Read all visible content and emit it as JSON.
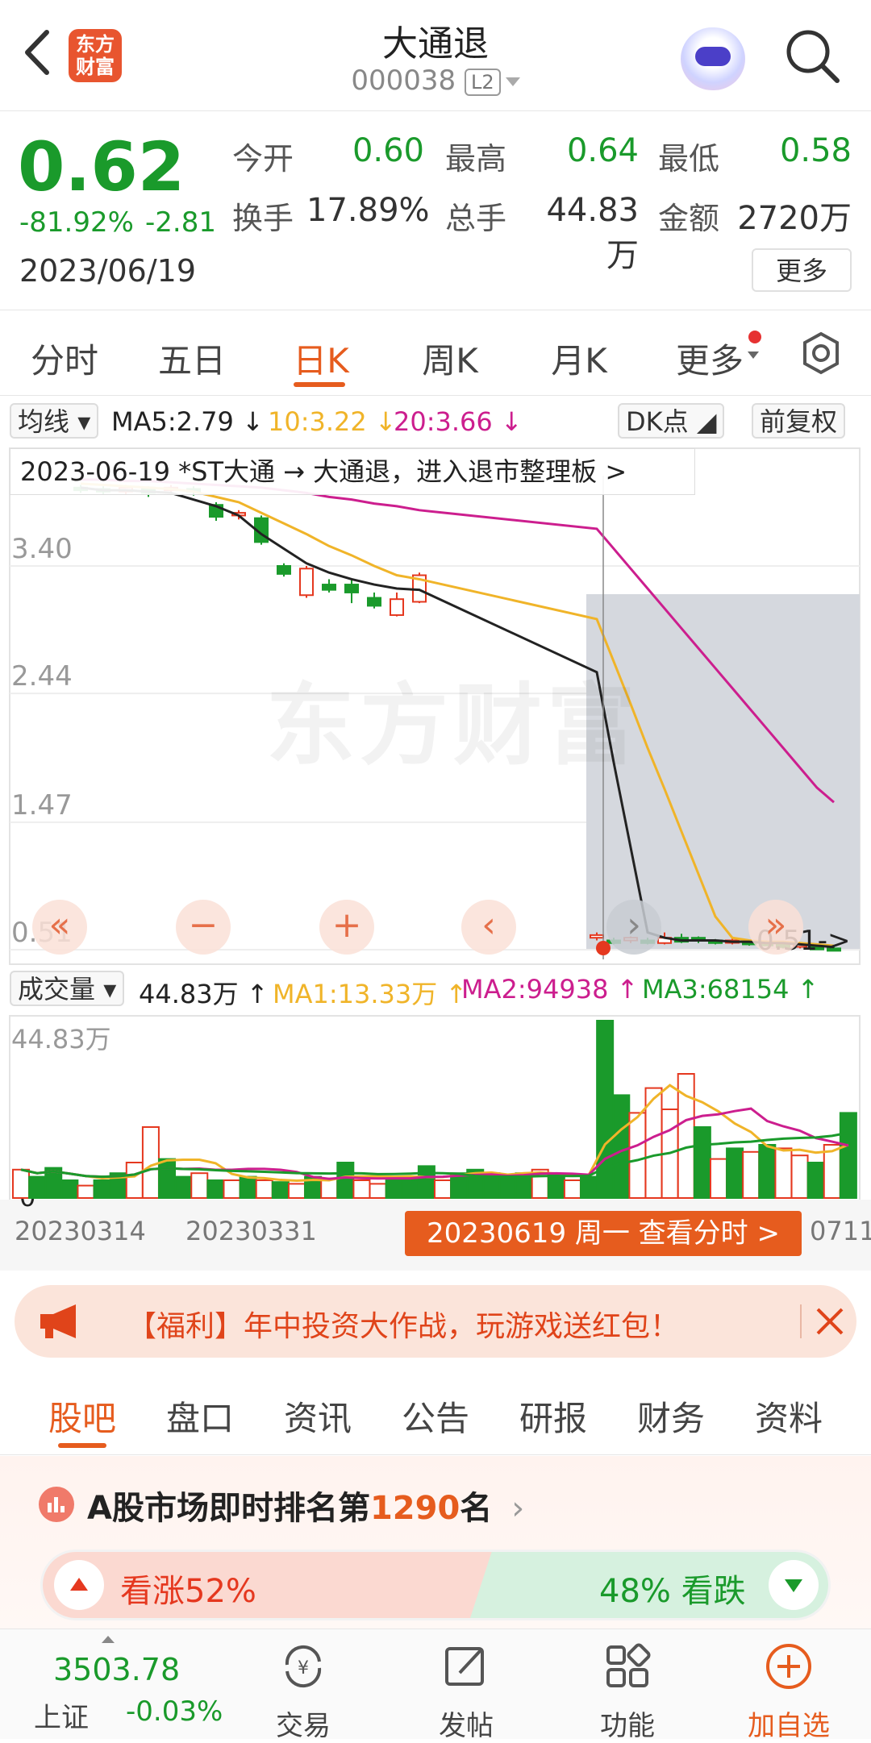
{
  "header": {
    "logo_text": "东方财富",
    "stock_name": "大通退",
    "stock_code": "000038",
    "level_badge": "L2",
    "icons": [
      "back-icon",
      "robot-avatar-icon",
      "search-icon"
    ]
  },
  "quote": {
    "price": "0.62",
    "change_pct": "-81.92%",
    "change": "-2.81",
    "date": "2023/06/19",
    "open_label": "今开",
    "open": "0.60",
    "high_label": "最高",
    "high": "0.64",
    "low_label": "最低",
    "low": "0.58",
    "turnover_label": "换手",
    "turnover": "17.89%",
    "volume_label": "总手",
    "volume": "44.83万",
    "amount_label": "金额",
    "amount": "2720万",
    "more_label": "更多",
    "colors": {
      "down": "#1a9a2b",
      "up": "#e5381f"
    }
  },
  "period_tabs": {
    "items": [
      "分时",
      "五日",
      "日K",
      "周K",
      "月K",
      "更多"
    ],
    "active": "日K"
  },
  "ma_legend": {
    "selector": "均线",
    "ma5": "MA5:2.79 ↓",
    "ma10": "10:3.22 ↓",
    "ma20": "20:3.66 ↓",
    "dk_label": "DK点",
    "adjust_label": "前复权",
    "colors": {
      "ma5": "#222222",
      "ma10": "#f0b429",
      "ma20": "#cc1e8e"
    }
  },
  "chart_data": {
    "type": "candlestick",
    "event_banner": "2023-06-19 *ST大通 → 大通退，进入退市整理板 >",
    "watermark": "东方财富",
    "y_ticks": [
      "3.40",
      "2.44",
      "1.47",
      "0.51"
    ],
    "last_label": "0.51->",
    "x_ticks": [
      "20230314",
      "20230331",
      "0711"
    ],
    "ylim": [
      0.51,
      4.0
    ],
    "candles": [
      {
        "o": 3.99,
        "c": 3.97,
        "h": 4.01,
        "l": 3.95
      },
      {
        "o": 3.98,
        "c": 3.96,
        "h": 4.0,
        "l": 3.94
      },
      {
        "o": 3.96,
        "c": 3.99,
        "h": 4.01,
        "l": 3.94
      },
      {
        "o": 3.99,
        "c": 3.95,
        "h": 4.0,
        "l": 3.92
      },
      {
        "o": 3.97,
        "c": 3.99,
        "h": 4.01,
        "l": 3.95
      },
      {
        "o": 3.98,
        "c": 3.96,
        "h": 4.0,
        "l": 3.93
      },
      {
        "o": 3.86,
        "c": 3.77,
        "h": 3.88,
        "l": 3.74
      },
      {
        "o": 3.78,
        "c": 3.8,
        "h": 3.82,
        "l": 3.75
      },
      {
        "o": 3.76,
        "c": 3.58,
        "h": 3.78,
        "l": 3.56
      },
      {
        "o": 3.4,
        "c": 3.34,
        "h": 3.42,
        "l": 3.32
      },
      {
        "o": 3.18,
        "c": 3.38,
        "h": 3.4,
        "l": 3.16
      },
      {
        "o": 3.26,
        "c": 3.22,
        "h": 3.3,
        "l": 3.2
      },
      {
        "o": 3.26,
        "c": 3.2,
        "h": 3.3,
        "l": 3.12
      },
      {
        "o": 3.16,
        "c": 3.1,
        "h": 3.2,
        "l": 3.08
      },
      {
        "o": 3.03,
        "c": 3.15,
        "h": 3.2,
        "l": 3.02
      },
      {
        "o": 3.13,
        "c": 3.33,
        "h": 3.35,
        "l": 3.12
      },
      {
        "o": 0.6,
        "c": 0.62,
        "h": 0.64,
        "l": 0.58
      },
      {
        "o": 0.58,
        "c": 0.56,
        "h": 0.6,
        "l": 0.55
      },
      {
        "o": 0.58,
        "c": 0.6,
        "h": 0.61,
        "l": 0.56
      },
      {
        "o": 0.58,
        "c": 0.56,
        "h": 0.6,
        "l": 0.55
      },
      {
        "o": 0.56,
        "c": 0.6,
        "h": 0.64,
        "l": 0.55
      },
      {
        "o": 0.6,
        "c": 0.57,
        "h": 0.63,
        "l": 0.56
      },
      {
        "o": 0.6,
        "c": 0.58,
        "h": 0.61,
        "l": 0.56
      },
      {
        "o": 0.58,
        "c": 0.56,
        "h": 0.59,
        "l": 0.55
      },
      {
        "o": 0.57,
        "c": 0.58,
        "h": 0.6,
        "l": 0.55
      },
      {
        "o": 0.57,
        "c": 0.55,
        "h": 0.58,
        "l": 0.54
      },
      {
        "o": 0.56,
        "c": 0.55,
        "h": 0.58,
        "l": 0.54
      },
      {
        "o": 0.55,
        "c": 0.53,
        "h": 0.56,
        "l": 0.52
      },
      {
        "o": 0.54,
        "c": 0.55,
        "h": 0.56,
        "l": 0.52
      },
      {
        "o": 0.53,
        "c": 0.52,
        "h": 0.55,
        "l": 0.51
      },
      {
        "o": 0.52,
        "c": 0.51,
        "h": 0.54,
        "l": 0.51
      }
    ],
    "ma5_line": [
      3.99,
      3.97,
      3.97,
      3.96,
      3.95,
      3.9,
      3.85,
      3.78,
      3.64,
      3.53,
      3.42,
      3.35,
      3.3,
      3.26,
      3.23,
      3.22,
      2.6,
      1.92,
      1.28,
      0.64,
      0.6,
      0.58,
      0.58,
      0.58,
      0.57,
      0.57,
      0.56,
      0.56,
      0.55,
      0.54,
      0.53
    ],
    "ma10_line": [
      4.02,
      4.01,
      4.0,
      3.99,
      3.98,
      3.96,
      3.92,
      3.88,
      3.8,
      3.72,
      3.64,
      3.55,
      3.48,
      3.4,
      3.33,
      3.3,
      3.0,
      2.68,
      2.36,
      2.03,
      1.72,
      1.4,
      1.08,
      0.76,
      0.6,
      0.58,
      0.57,
      0.57,
      0.56,
      0.55,
      0.54
    ],
    "ma20_line": [
      4.05,
      4.05,
      4.04,
      4.04,
      4.03,
      4.02,
      4.01,
      4.0,
      3.99,
      3.97,
      3.95,
      3.92,
      3.9,
      3.87,
      3.85,
      3.82,
      3.68,
      3.53,
      3.38,
      3.23,
      3.08,
      2.93,
      2.78,
      2.63,
      2.48,
      2.33,
      2.18,
      2.03,
      1.88,
      1.73,
      1.62
    ]
  },
  "volume": {
    "selector": "成交量",
    "value": "44.83万 ↑",
    "ma1": "MA1:13.33万 ↑",
    "ma2": "MA2:94938 ↑",
    "ma3": "MA3:68154 ↑",
    "top_label": "44.83万",
    "zero_label": "0",
    "date_tip": "20230619 周一 查看分时 >",
    "colors": {
      "ma1": "#f0b429",
      "ma2": "#cc1e8e",
      "ma3": "#1a9a2b"
    },
    "bars": [
      {
        "v": 0.16,
        "up": true
      },
      {
        "v": 0.12,
        "up": false
      },
      {
        "v": 0.17,
        "up": false
      },
      {
        "v": 0.1,
        "up": false
      },
      {
        "v": 0.07,
        "up": true
      },
      {
        "v": 0.1,
        "up": false
      },
      {
        "v": 0.14,
        "up": false
      },
      {
        "v": 0.2,
        "up": true
      },
      {
        "v": 0.4,
        "up": true
      },
      {
        "v": 0.22,
        "up": false
      },
      {
        "v": 0.12,
        "up": false
      },
      {
        "v": 0.14,
        "up": true
      },
      {
        "v": 0.1,
        "up": false
      },
      {
        "v": 0.1,
        "up": true
      },
      {
        "v": 0.12,
        "up": false
      },
      {
        "v": 0.1,
        "up": true
      },
      {
        "v": 0.09,
        "up": false
      },
      {
        "v": 0.08,
        "up": true
      },
      {
        "v": 0.12,
        "up": false
      },
      {
        "v": 0.11,
        "up": true
      },
      {
        "v": 0.2,
        "up": false
      },
      {
        "v": 0.1,
        "up": true
      },
      {
        "v": 0.08,
        "up": true
      },
      {
        "v": 0.11,
        "up": false
      },
      {
        "v": 0.12,
        "up": false
      },
      {
        "v": 0.18,
        "up": false
      },
      {
        "v": 0.1,
        "up": true
      },
      {
        "v": 0.14,
        "up": false
      },
      {
        "v": 0.16,
        "up": false
      },
      {
        "v": 0.14,
        "up": false
      },
      {
        "v": 0.12,
        "up": false
      },
      {
        "v": 0.14,
        "up": false
      },
      {
        "v": 0.16,
        "up": true
      },
      {
        "v": 0.13,
        "up": false
      },
      {
        "v": 0.1,
        "up": true
      },
      {
        "v": 0.12,
        "up": false
      },
      {
        "v": 1.0,
        "up": false
      },
      {
        "v": 0.58,
        "up": false
      },
      {
        "v": 0.48,
        "up": true
      },
      {
        "v": 0.62,
        "up": true
      },
      {
        "v": 0.5,
        "up": true
      },
      {
        "v": 0.7,
        "up": true
      },
      {
        "v": 0.4,
        "up": false
      },
      {
        "v": 0.22,
        "up": true
      },
      {
        "v": 0.28,
        "up": false
      },
      {
        "v": 0.26,
        "up": true
      },
      {
        "v": 0.3,
        "up": false
      },
      {
        "v": 0.28,
        "up": true
      },
      {
        "v": 0.24,
        "up": true
      },
      {
        "v": 0.2,
        "up": false
      },
      {
        "v": 0.3,
        "up": true
      },
      {
        "v": 0.48,
        "up": false
      }
    ]
  },
  "promo": {
    "text": "【福利】年中投资大作战，玩游戏送红包！"
  },
  "info_tabs": {
    "items": [
      "股吧",
      "盘口",
      "资讯",
      "公告",
      "研报",
      "财务",
      "资料"
    ],
    "active": "股吧"
  },
  "rank": {
    "prefix": "A股市场即时排名第",
    "number": "1290",
    "suffix": "名",
    "bull_label": "看涨52%",
    "bear_label": "48% 看跌"
  },
  "bottom_nav": {
    "index_value": "3503.78",
    "index_name": "上证",
    "index_change": "-0.03%",
    "items": [
      {
        "label": "交易",
        "icon": "trade-icon"
      },
      {
        "label": "发帖",
        "icon": "post-icon"
      },
      {
        "label": "功能",
        "icon": "function-icon"
      },
      {
        "label": "加自选",
        "icon": "add-watchlist-icon"
      }
    ]
  }
}
